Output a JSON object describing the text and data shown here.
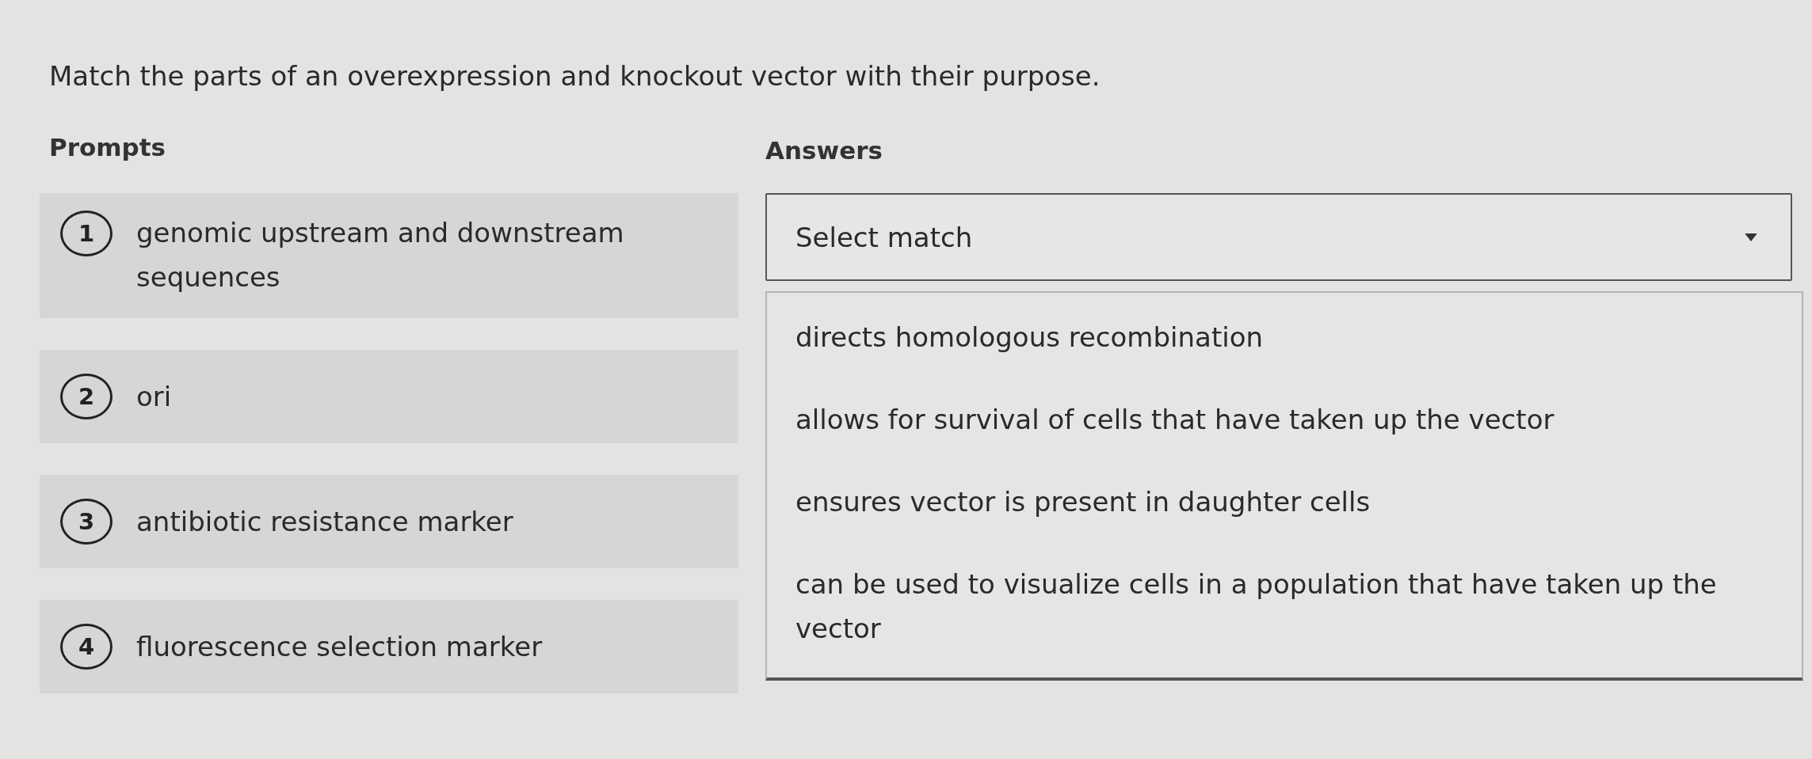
{
  "question": "Match the parts of an overexpression and knockout vector with their purpose.",
  "prompts_heading": "Prompts",
  "answers_heading": "Answers",
  "prompts": [
    {
      "number": "1",
      "text": "genomic upstream and downstream sequences"
    },
    {
      "number": "2",
      "text": "ori"
    },
    {
      "number": "3",
      "text": "antibiotic resistance marker"
    },
    {
      "number": "4",
      "text": "fluorescence selection marker"
    }
  ],
  "select": {
    "label": "Select match",
    "expanded": true
  },
  "options": [
    "directs homologous recombination",
    "allows for survival of cells that have taken up the vector",
    "ensures vector is present in daughter cells",
    "can be used to visualize cells in a population that have taken up the vector"
  ]
}
